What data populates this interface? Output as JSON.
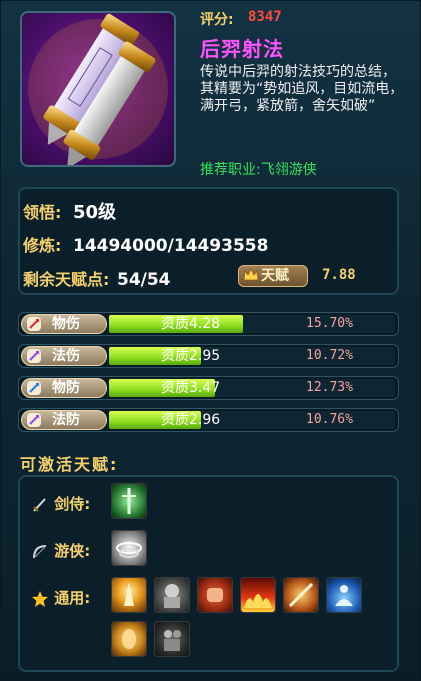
{
  "item": {
    "score_label": "评分:",
    "score_value": "8347",
    "name": "后羿射法",
    "description": "传说中后羿的射法技巧的总结，其精要为“势如追风，目如流电，满开弓，紧放箭，舍矢如破”",
    "recommend": "推荐职业:飞翎游侠",
    "icon": "scroll-pair-icon"
  },
  "stats": {
    "comprehension_label": "领悟:",
    "comprehension_value": "50级",
    "cultivation_label": "修炼:",
    "cultivation_value": "14494000/14493558",
    "talent_points_label": "剩余天赋点:",
    "talent_points_value": "54/54",
    "talent_button_label": "天赋",
    "talent_value": "7.88"
  },
  "bars": [
    {
      "label": "物伤",
      "icon": "sword-icon",
      "icon_color": "#d8342c",
      "quality": "资质4.28",
      "fill": 0.47,
      "percent": "15.70%"
    },
    {
      "label": "法伤",
      "icon": "lightning-icon",
      "icon_color": "#9d4de0",
      "quality": "资质2.95",
      "fill": 0.32,
      "percent": "10.72%"
    },
    {
      "label": "物防",
      "icon": "shield-icon",
      "icon_color": "#2f7fdc",
      "quality": "资质3.47",
      "fill": 0.37,
      "percent": "12.73%"
    },
    {
      "label": "法防",
      "icon": "magic-shield-icon",
      "icon_color": "#9d4de0",
      "quality": "资质2.96",
      "fill": 0.32,
      "percent": "10.76%"
    }
  ],
  "activatable": {
    "title": "可激活天赋:",
    "rows": [
      {
        "label": "剑侍:",
        "icon": "sword-icon"
      },
      {
        "label": "游侠:",
        "icon": "bow-icon"
      },
      {
        "label": "通用:",
        "icon": "star-icon"
      }
    ],
    "talent_icons": [
      "sword-talent-icon",
      "whirlwind-talent-icon",
      "golden-burst-icon",
      "stone-guardian-icon",
      "fist-strike-icon",
      "flame-wave-icon",
      "blade-slash-icon",
      "meditation-icon",
      "golden-face-icon",
      "shadow-figure-icon"
    ]
  }
}
